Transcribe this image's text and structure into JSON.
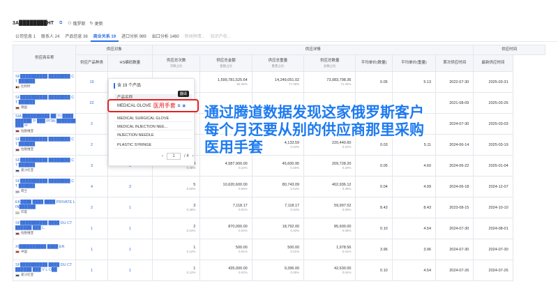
{
  "company": {
    "name": "3A████████HT",
    "russia": "俄罗斯",
    "update": "更新"
  },
  "tabs": [
    "公司信息 1",
    "联系人 24",
    "产品信息 38",
    "商业关系 19",
    "进口分析 989",
    "出口分析 1460",
    "新闻舆情...",
    "知识产权..."
  ],
  "header": {
    "name": "供应商名称",
    "group_target": "供应对象",
    "group_detail": "供应详情",
    "group_time": "供应时间",
    "cols": [
      {
        "t": "供应产品种类",
        "s": ""
      },
      {
        "t": "HS编码数量",
        "s": ""
      },
      {
        "t": "供应总次数",
        "s": "次数占比"
      },
      {
        "t": "供应总金额",
        "s": "金额占比"
      },
      {
        "t": "供应总重量",
        "s": "重量占比"
      },
      {
        "t": "供应总数量",
        "s": "总数占比"
      },
      {
        "t": "平均单价(数量)",
        "s": ""
      },
      {
        "t": "平均单价(重量)",
        "s": ""
      },
      {
        "t": "首次供应时间",
        "s": ""
      },
      {
        "t": "最新供应时间",
        "s": ""
      }
    ]
  },
  "rows": [
    {
      "name": "SF██████████ ████████ CT ██████",
      "country": "比利时",
      "products": "19",
      "hs": "",
      "count": "",
      "countp": "",
      "amount": "1,599,781,525.64",
      "amountp": "82.35%",
      "weight": "14,249,051.02",
      "weightp": "77.38%",
      "qty": "73,083,798.36",
      "qtyp": "71.35%",
      "avgq": "0.05",
      "avgw": "5.13",
      "first": "2022-07-30",
      "last": "2025-03-31"
    },
    {
      "name": "SF██████████ ████████ CT ██████",
      "country": "德国",
      "products": "22",
      "hs": "",
      "count": "",
      "countp": "",
      "amount": "",
      "amountp": "",
      "weight": "",
      "weightp": "",
      "qty": "",
      "qtyp": "",
      "avgq": "",
      "avgw": "",
      "first": "2021-08-09",
      "last": "2025-03-26"
    },
    {
      "name": "SIA ██████████ ██ 'TI ██████████ 'P ███ PITAI ██████████ H",
      "country": "拉脱维亚",
      "products": "2",
      "hs": "",
      "count": "",
      "countp": "",
      "amount": "",
      "amountp": "",
      "weight": "",
      "weightp": "",
      "qty": "",
      "qtyp": "",
      "avgq": "",
      "avgw": "",
      "first": "2024-07-30",
      "last": "2025-03-03"
    },
    {
      "name": "SF██████████ ████████ CT ██████",
      "country": "拉脱维亚",
      "products": "2",
      "hs": "",
      "count": "",
      "countp": "",
      "amount": "",
      "amountp": "0.38%",
      "weight": "4,133.59",
      "weightp": "0.23%",
      "qty": "220,440.60",
      "qtyp": "0.22%",
      "avgq": "0.03",
      "avgw": "5.11",
      "first": "2024-06-14",
      "last": "2025-03-19"
    },
    {
      "name": "SF██████████ ████████ CT ██████",
      "country": "爱沙尼亚",
      "products": "3",
      "hs": "3",
      "count": "4",
      "countp": "0.48%",
      "amount": "4,587,900.00",
      "amountp": "0.24%",
      "weight": "45,600.95",
      "weightp": "0.25%",
      "qty": "209,728.20",
      "qtyp": "0.20%",
      "avgq": "0.05",
      "avgw": "4.60",
      "first": "2024-06-22",
      "last": "2025-01-04"
    },
    {
      "name": "SF██████████ ████████ CT ██████",
      "country": "荷兰",
      "products": "4",
      "hs": "3",
      "count": "5",
      "countp": "0.60%",
      "amount": "10,620,600.00",
      "amountp": "0.55%",
      "weight": "80,743.09",
      "weightp": "0.44%",
      "qty": "402,936.12",
      "qtyp": "0.39%",
      "avgq": "0.04",
      "avgw": "4.99",
      "first": "2024-06-18",
      "last": "2024-12-07"
    },
    {
      "name": "EK████ ████ ████ PRIVATE LIN██████",
      "country": "印度",
      "products": "2",
      "hs": "1",
      "count": "3",
      "countp": "0.36%",
      "amount": "7,118.17",
      "amountp": "0.01%",
      "weight": "7,118.17",
      "weightp": "0.04%",
      "qty": "59,997.52",
      "qtyp": "0.06%",
      "avgq": "8.43",
      "avgw": "8.43",
      "first": "2023-08-15",
      "last": "2024-10-10"
    },
    {
      "name": "SF██████████ ████ DU CT ██████ ███ L.",
      "country": "拉脱维亚",
      "products": "1",
      "hs": "1",
      "count": "2",
      "countp": "0.24%",
      "amount": "870,000.00",
      "amountp": "0.04%",
      "weight": "18,792.00",
      "weightp": "0.10%",
      "qty": "85,600.00",
      "qtyp": "0.08%",
      "avgq": "0.10",
      "avgw": "4.54",
      "first": "2024-07-30",
      "last": "2024-08-01"
    },
    {
      "name": "XI██████████ ████ ER",
      "country": "中国",
      "products": "1",
      "hs": "1",
      "count": "1",
      "countp": "0.12%",
      "amount": "500.00",
      "amountp": "0.01%",
      "weight": "500.00",
      "weightp": "0.01%",
      "qty": "1,978.56",
      "qtyp": "0.01%",
      "avgq": "3.96",
      "avgw": "3.96",
      "first": "2024-07-30",
      "last": "2024-07-30"
    },
    {
      "name": "SF██████████ ████ DU CT ██████ ███ V L O██",
      "country": "爱沙尼亚",
      "products": "1",
      "hs": "1",
      "count": "1",
      "countp": "0.12%",
      "amount": "435,000.00",
      "amountp": "0.02%",
      "weight": "9,396.00",
      "weightp": "0.05%",
      "qty": "42,630.00",
      "qtyp": "0.04%",
      "avgq": "0.10",
      "avgw": "4.54",
      "first": "2024-07-26",
      "last": "2024-07-26"
    }
  ],
  "popup": {
    "title": "含 19 个产品",
    "col": "产品名称",
    "items": [
      "MEDICAL GLOVE",
      "MEDICAL SURGICAL GLOVE",
      "MEDICAL INJECTION NEE...",
      "INJECTION NEEDLE",
      "PLASTIC SYRINGE"
    ],
    "highlight_cn": "医用手套",
    "tooltip": "翻译",
    "page": "1",
    "total": "/ 4"
  },
  "overlay": [
    "通过腾道数据发现这家俄罗斯客户",
    "每个月还要从别的供应商那里采购",
    "医用手套"
  ]
}
